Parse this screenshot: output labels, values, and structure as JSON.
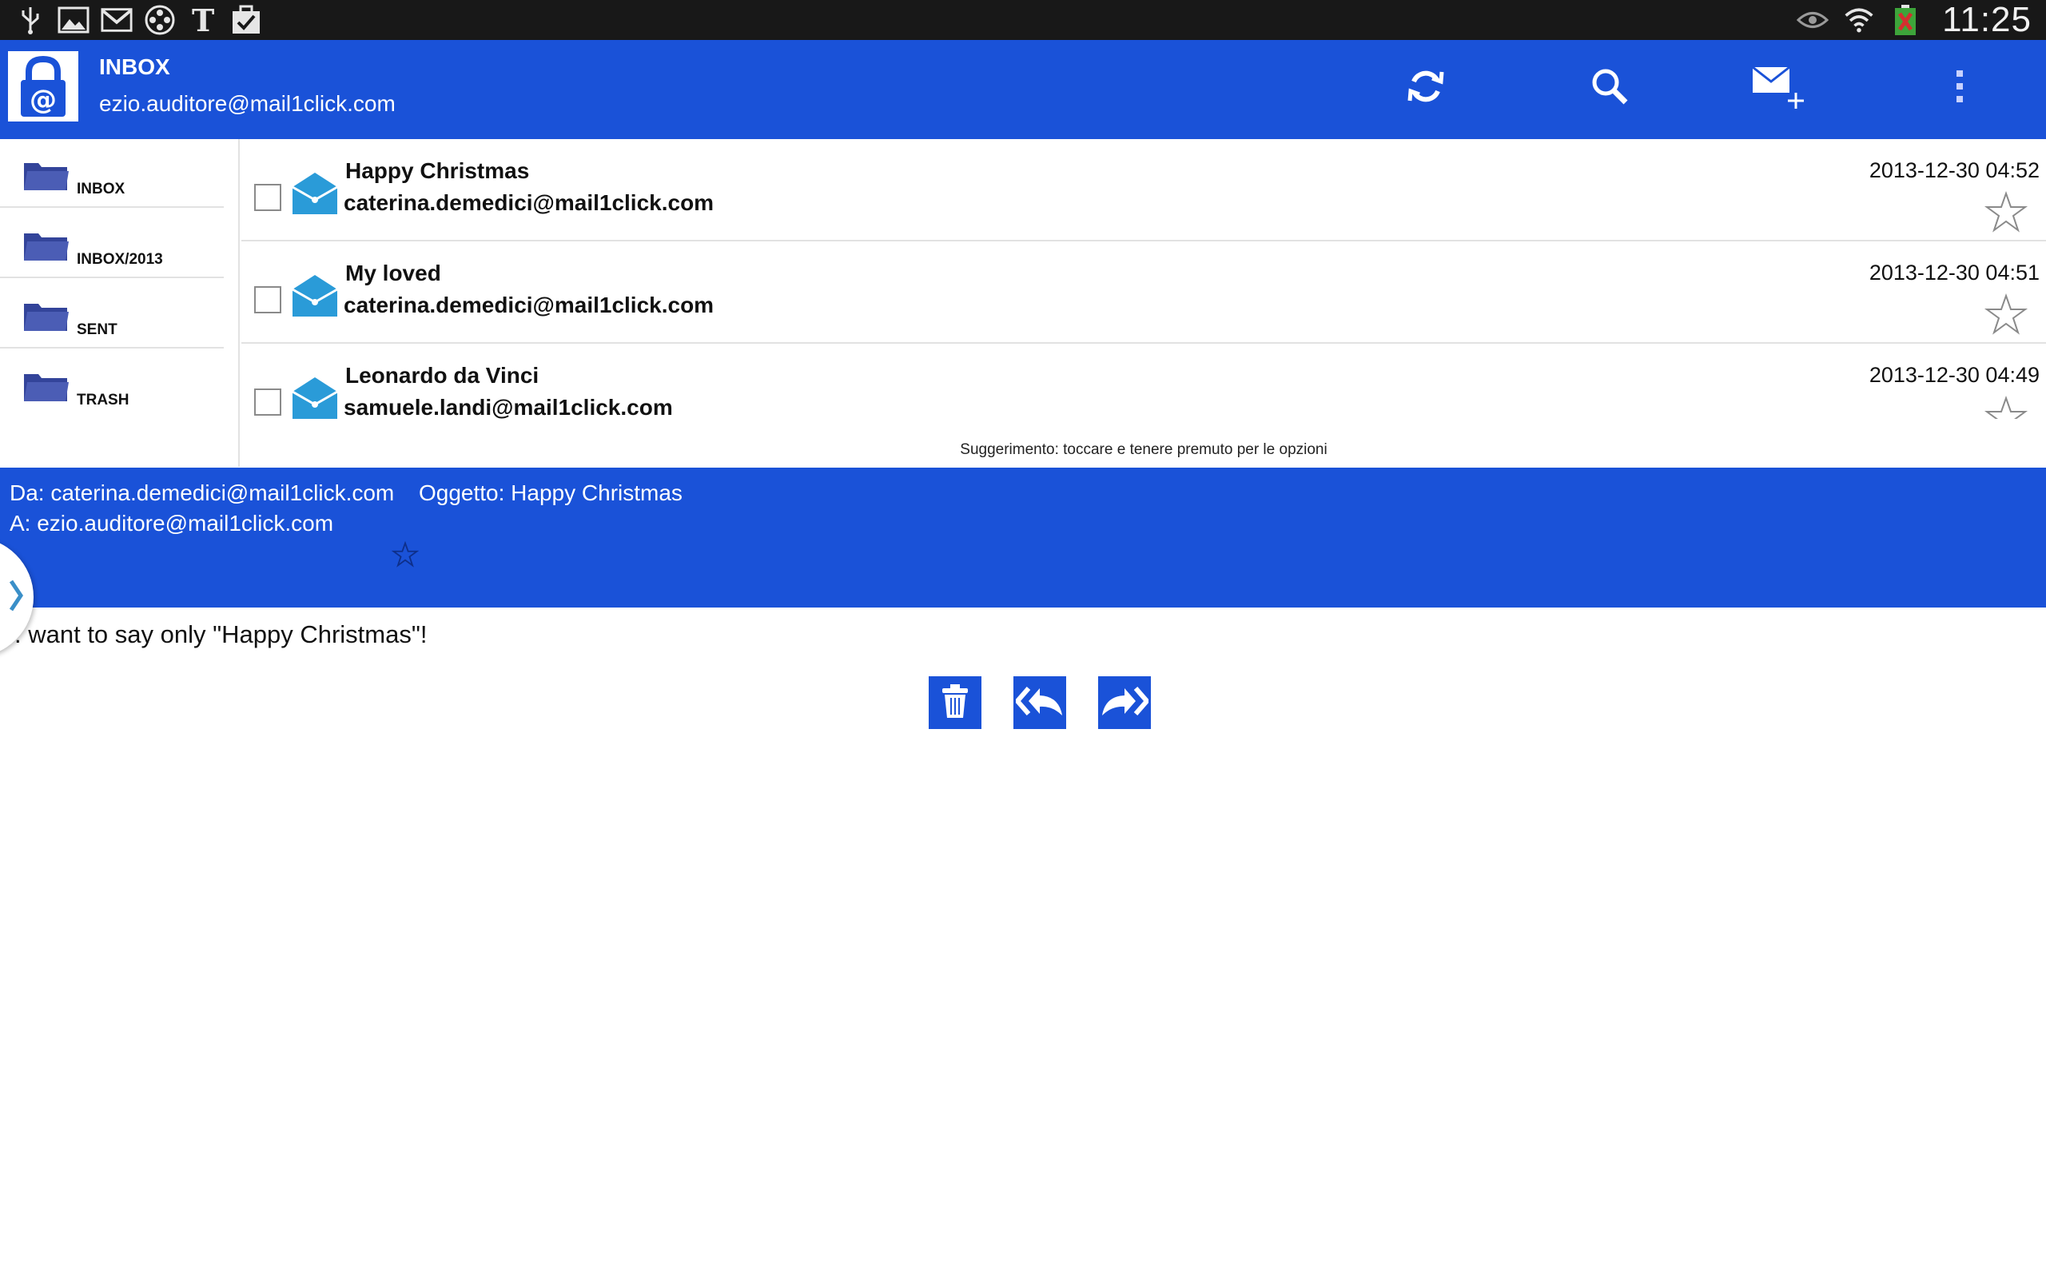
{
  "statusbar": {
    "left_icons": [
      "usb-icon",
      "image-icon",
      "gmail-icon",
      "reel-icon",
      "nytimes-icon",
      "task-icon"
    ],
    "right_icons": [
      "eye-icon",
      "wifi-icon",
      "battery-icon"
    ],
    "clock": "11:25"
  },
  "actionbar": {
    "title": "INBOX",
    "account": "ezio.auditore@mail1click.com",
    "actions": [
      "refresh-icon",
      "search-icon",
      "compose-icon",
      "overflow-menu-icon"
    ]
  },
  "sidebar": {
    "folders": [
      {
        "label": "INBOX"
      },
      {
        "label": "INBOX/2013"
      },
      {
        "label": "SENT"
      },
      {
        "label": "TRASH"
      }
    ]
  },
  "messages": [
    {
      "subject": "Happy Christmas",
      "from": "caterina.demedici@mail1click.com",
      "date": "2013-12-30 04:52"
    },
    {
      "subject": "My loved",
      "from": "caterina.demedici@mail1click.com",
      "date": "2013-12-30 04:51"
    },
    {
      "subject": "Leonardo da Vinci",
      "from": "samuele.landi@mail1click.com",
      "date": "2013-12-30 04:49"
    }
  ],
  "hint": "Suggerimento: toccare e tenere premuto per le opzioni",
  "preview": {
    "from": "Da: caterina.demedici@mail1click.com",
    "subject": "Oggetto: Happy Christmas",
    "to": "A: ezio.auditore@mail1click.com",
    "body": ". want to say only \"Happy Christmas\"!"
  },
  "colors": {
    "accent": "#1a52d8",
    "folder": "#33449a",
    "envelope": "#2a9bd8",
    "statusbar": "#181818"
  }
}
